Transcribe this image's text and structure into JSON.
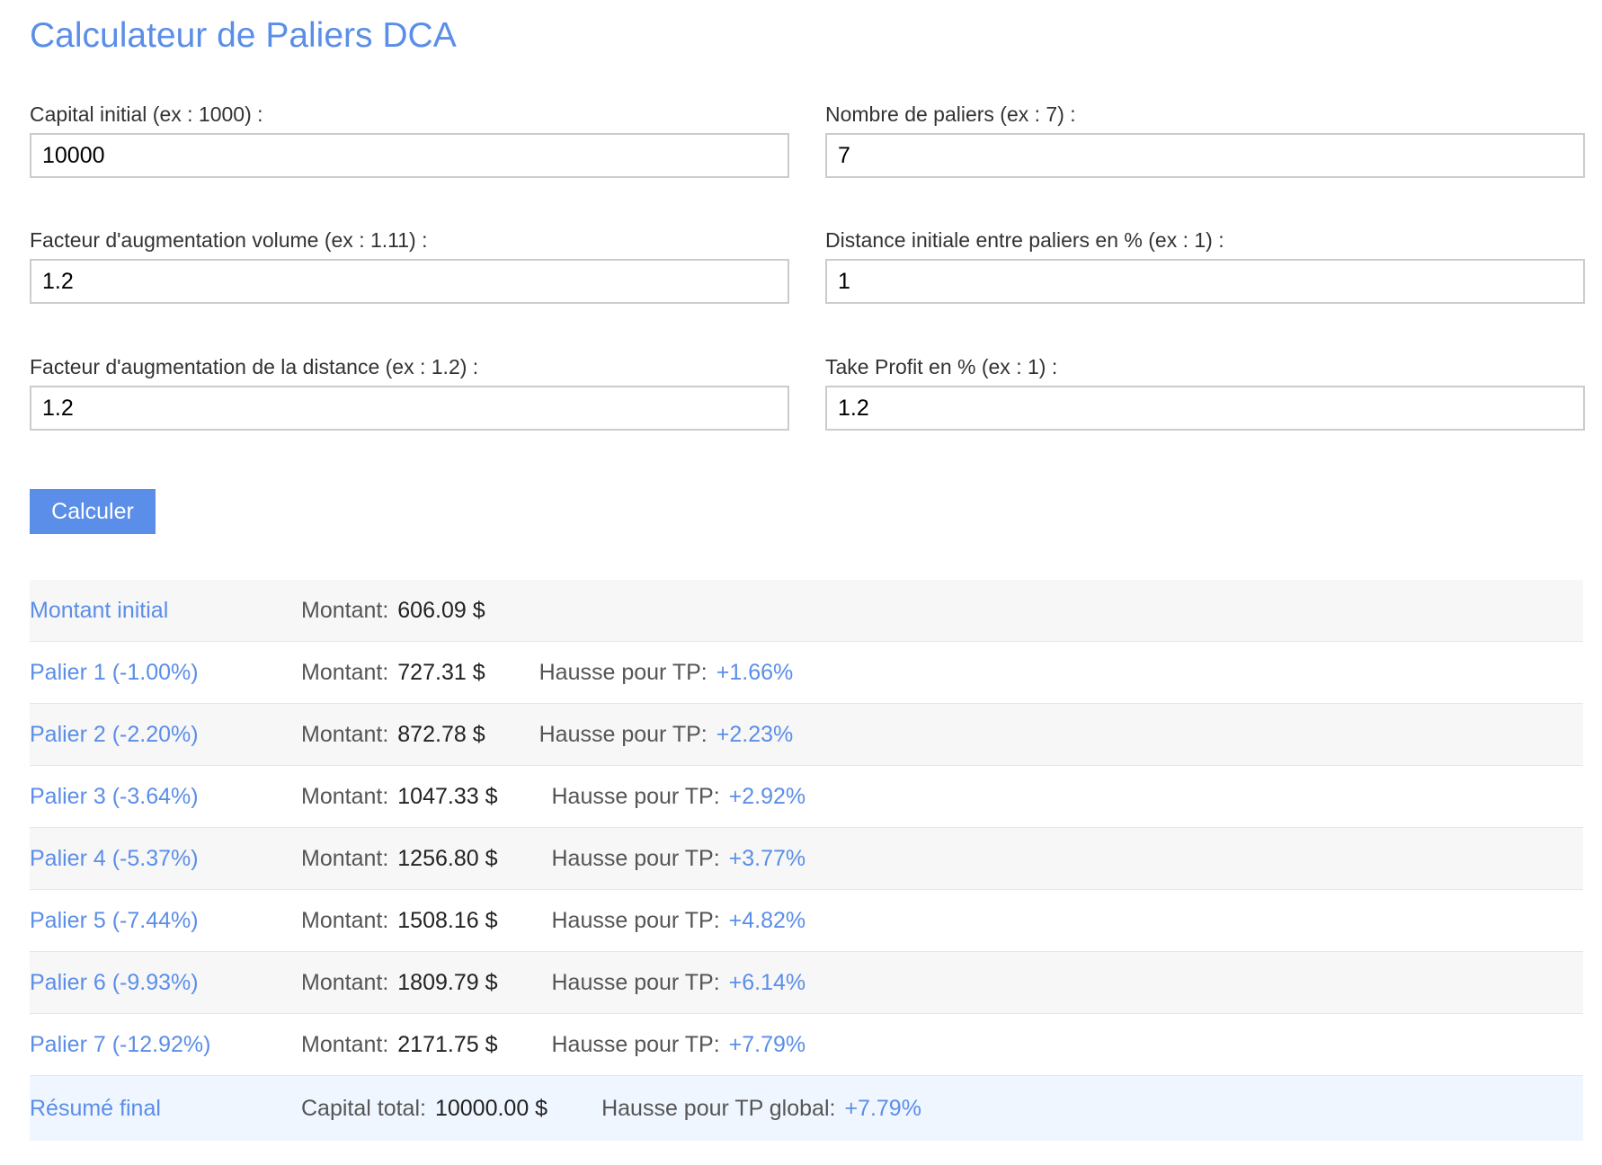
{
  "page": {
    "title": "Calculateur de Paliers DCA"
  },
  "form": {
    "capital": {
      "label": "Capital initial (ex : 1000) :",
      "value": "10000"
    },
    "paliers": {
      "label": "Nombre de paliers (ex : 7) :",
      "value": "7"
    },
    "volume_factor": {
      "label": "Facteur d'augmentation volume (ex : 1.11) :",
      "value": "1.2"
    },
    "distance_initial": {
      "label": "Distance initiale entre paliers en % (ex : 1) :",
      "value": "1"
    },
    "distance_factor": {
      "label": "Facteur d'augmentation de la distance (ex : 1.2) :",
      "value": "1.2"
    },
    "take_profit": {
      "label": "Take Profit en % (ex : 1) :",
      "value": "1.2"
    },
    "submit_label": "Calculer"
  },
  "results": {
    "initial": {
      "name": "Montant initial",
      "montant_label": "Montant:",
      "montant": "606.09 $"
    },
    "paliers": [
      {
        "name": "Palier 1 (-1.00%)",
        "montant_label": "Montant:",
        "montant": "727.31 $",
        "tp_label": "Hausse pour TP:",
        "tp": "+1.66%"
      },
      {
        "name": "Palier 2 (-2.20%)",
        "montant_label": "Montant:",
        "montant": "872.78 $",
        "tp_label": "Hausse pour TP:",
        "tp": "+2.23%"
      },
      {
        "name": "Palier 3 (-3.64%)",
        "montant_label": "Montant:",
        "montant": "1047.33 $",
        "tp_label": "Hausse pour TP:",
        "tp": "+2.92%"
      },
      {
        "name": "Palier 4 (-5.37%)",
        "montant_label": "Montant:",
        "montant": "1256.80 $",
        "tp_label": "Hausse pour TP:",
        "tp": "+3.77%"
      },
      {
        "name": "Palier 5 (-7.44%)",
        "montant_label": "Montant:",
        "montant": "1508.16 $",
        "tp_label": "Hausse pour TP:",
        "tp": "+4.82%"
      },
      {
        "name": "Palier 6 (-9.93%)",
        "montant_label": "Montant:",
        "montant": "1809.79 $",
        "tp_label": "Hausse pour TP:",
        "tp": "+6.14%"
      },
      {
        "name": "Palier 7 (-12.92%)",
        "montant_label": "Montant:",
        "montant": "2171.75 $",
        "tp_label": "Hausse pour TP:",
        "tp": "+7.79%"
      }
    ],
    "summary": {
      "name": "Résumé final",
      "capital_label": "Capital total:",
      "capital": "10000.00 $",
      "tp_label": "Hausse pour TP global:",
      "tp": "+7.79%"
    }
  },
  "colors": {
    "accent": "#5b8ee8",
    "row_alt": "#f7f7f7",
    "summary_bg": "#eff6ff"
  }
}
